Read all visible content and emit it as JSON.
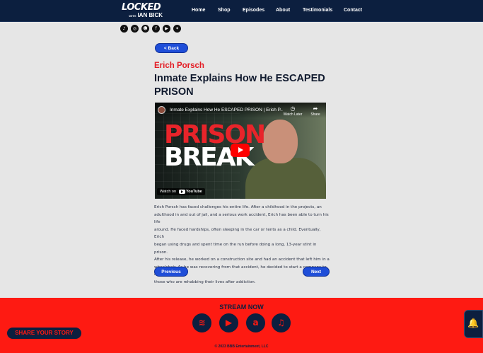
{
  "brand": {
    "logo_main": "LOCKED",
    "logo_with": "WITH",
    "logo_name": "IAN BICK"
  },
  "nav": {
    "items": [
      "Home",
      "Shop",
      "Episodes",
      "About",
      "Testimonials",
      "Contact"
    ]
  },
  "social": {
    "icons": [
      "tiktok-icon",
      "instagram-icon",
      "snapchat-icon",
      "facebook-icon",
      "youtube-icon",
      "twitter-icon"
    ]
  },
  "back_label": "< Back",
  "episode": {
    "guest": "Erich Porsch",
    "title": "Inmate Explains How He ESCAPED PRISON",
    "description_lines": [
      "Erich Porsch has faced challenges his entire life. After a childhood in the projects, an",
      "adulthood in and out of jail, and a serious work accident, Erich has been able to turn his life",
      "around. He faced hardships, often sleeping in the car or tents as a child. Eventually, Erich",
      "began using drugs and spent time on the run before doing a long, 13-year stint in prison.",
      "After his release, he worked on a construction site and had an accident that left him in a",
      "wheelchair. As he was recovering from that accident, he decided to start a company to help",
      "those who are rehabbing their lives after addiction."
    ]
  },
  "video": {
    "title": "Inmate Explains How He ESCAPED PRISON | Erich P...",
    "watch_later": "Watch Later",
    "share": "Share",
    "thumb_line1": "PRISON",
    "thumb_line2": "BREAK",
    "watch_on": "Watch on",
    "youtube": "YouTube"
  },
  "pager": {
    "previous": "Previous",
    "next": "Next"
  },
  "footer": {
    "stream_now": "STREAM NOW",
    "platforms": [
      "spotify-icon",
      "youtube-icon",
      "amazon-icon",
      "apple-music-icon"
    ],
    "copyright": "© 2023 BBB Entertainment, LLC"
  },
  "share_story": "SHARE YOUR STORY",
  "colors": {
    "navy": "#0c1f3f",
    "red": "#fe1a12",
    "button_blue": "#1f4ed8",
    "guest_red": "#e41b23"
  }
}
